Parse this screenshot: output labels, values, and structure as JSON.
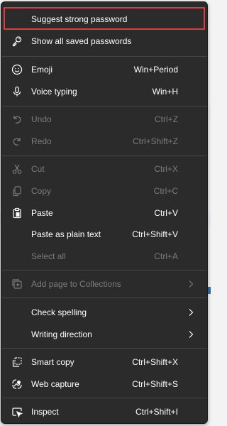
{
  "colors": {
    "menu_bg": "#2b2b2b",
    "text": "#ffffff",
    "disabled": "#7b7b7b",
    "highlight": "#e23b3b"
  },
  "items": [
    {
      "label": "Suggest strong password",
      "shortcut": "",
      "icon": "",
      "disabled": false,
      "highlighted": true
    },
    {
      "label": "Show all saved passwords",
      "shortcut": "",
      "icon": "key-icon",
      "disabled": false
    },
    {
      "label": "Emoji",
      "shortcut": "Win+Period",
      "icon": "emoji-icon",
      "disabled": false
    },
    {
      "label": "Voice typing",
      "shortcut": "Win+H",
      "icon": "microphone-icon",
      "disabled": false
    },
    {
      "label": "Undo",
      "shortcut": "Ctrl+Z",
      "icon": "undo-icon",
      "disabled": true
    },
    {
      "label": "Redo",
      "shortcut": "Ctrl+Shift+Z",
      "icon": "redo-icon",
      "disabled": true
    },
    {
      "label": "Cut",
      "shortcut": "Ctrl+X",
      "icon": "scissors-icon",
      "disabled": true
    },
    {
      "label": "Copy",
      "shortcut": "Ctrl+C",
      "icon": "copy-icon",
      "disabled": true
    },
    {
      "label": "Paste",
      "shortcut": "Ctrl+V",
      "icon": "clipboard-icon",
      "disabled": false
    },
    {
      "label": "Paste as plain text",
      "shortcut": "Ctrl+Shift+V",
      "icon": "",
      "disabled": false
    },
    {
      "label": "Select all",
      "shortcut": "Ctrl+A",
      "icon": "",
      "disabled": true
    },
    {
      "label": "Add page to Collections",
      "shortcut": "",
      "icon": "collections-icon",
      "disabled": true,
      "submenu": true
    },
    {
      "label": "Check spelling",
      "shortcut": "",
      "icon": "",
      "disabled": false,
      "submenu": true
    },
    {
      "label": "Writing direction",
      "shortcut": "",
      "icon": "",
      "disabled": false,
      "submenu": true
    },
    {
      "label": "Smart copy",
      "shortcut": "Ctrl+Shift+X",
      "icon": "smart-copy-icon",
      "disabled": false
    },
    {
      "label": "Web capture",
      "shortcut": "Ctrl+Shift+S",
      "icon": "web-capture-icon",
      "disabled": false
    },
    {
      "label": "Inspect",
      "shortcut": "Ctrl+Shift+I",
      "icon": "inspect-icon",
      "disabled": false
    }
  ]
}
